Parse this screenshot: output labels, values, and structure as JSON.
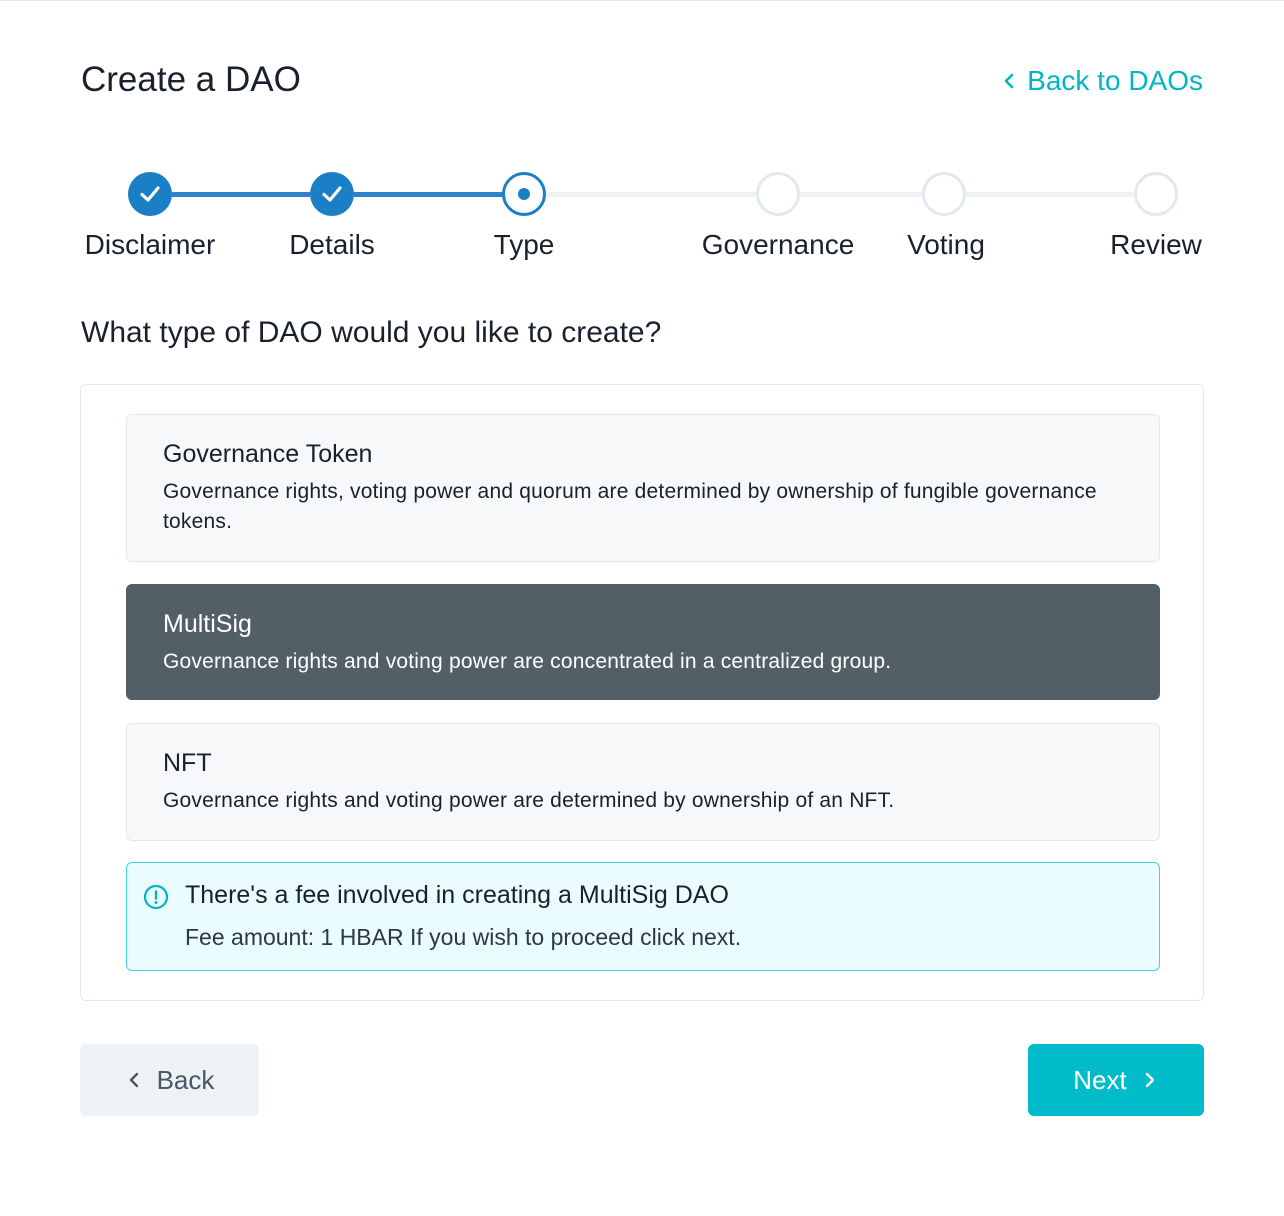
{
  "header": {
    "title": "Create a DAO",
    "back_link": "Back to DAOs"
  },
  "stepper": {
    "steps": [
      {
        "label": "Disclaimer",
        "status": "complete"
      },
      {
        "label": "Details",
        "status": "complete"
      },
      {
        "label": "Type",
        "status": "active"
      },
      {
        "label": "Governance",
        "status": "incomplete"
      },
      {
        "label": "Voting",
        "status": "incomplete"
      },
      {
        "label": "Review",
        "status": "incomplete"
      }
    ]
  },
  "question": "What type of DAO would you like to create?",
  "options": [
    {
      "title": "Governance Token",
      "description": "Governance rights, voting power and quorum are determined by ownership of fungible governance tokens.",
      "selected": false
    },
    {
      "title": "MultiSig",
      "description": "Governance rights and voting power are concentrated in a centralized group.",
      "selected": true
    },
    {
      "title": "NFT",
      "description": "Governance rights and voting power are determined by ownership of an NFT.",
      "selected": false
    }
  ],
  "alert": {
    "title": "There's a fee involved in creating a MultiSig DAO",
    "text": "Fee amount: 1 HBAR If you wish to proceed click next."
  },
  "footer": {
    "back_label": "Back",
    "next_label": "Next"
  },
  "colors": {
    "accent": "#00b5c5",
    "step_blue": "#1a7fc4",
    "selected_bg": "#525f66",
    "alert_bg": "#ebfcfe",
    "alert_border": "#3fd3e0"
  },
  "icons": {
    "back_link": "chevron-left-icon",
    "step_complete": "check-icon",
    "alert": "info-circle-icon",
    "back_button": "chevron-left-icon",
    "next_button": "chevron-right-icon"
  }
}
